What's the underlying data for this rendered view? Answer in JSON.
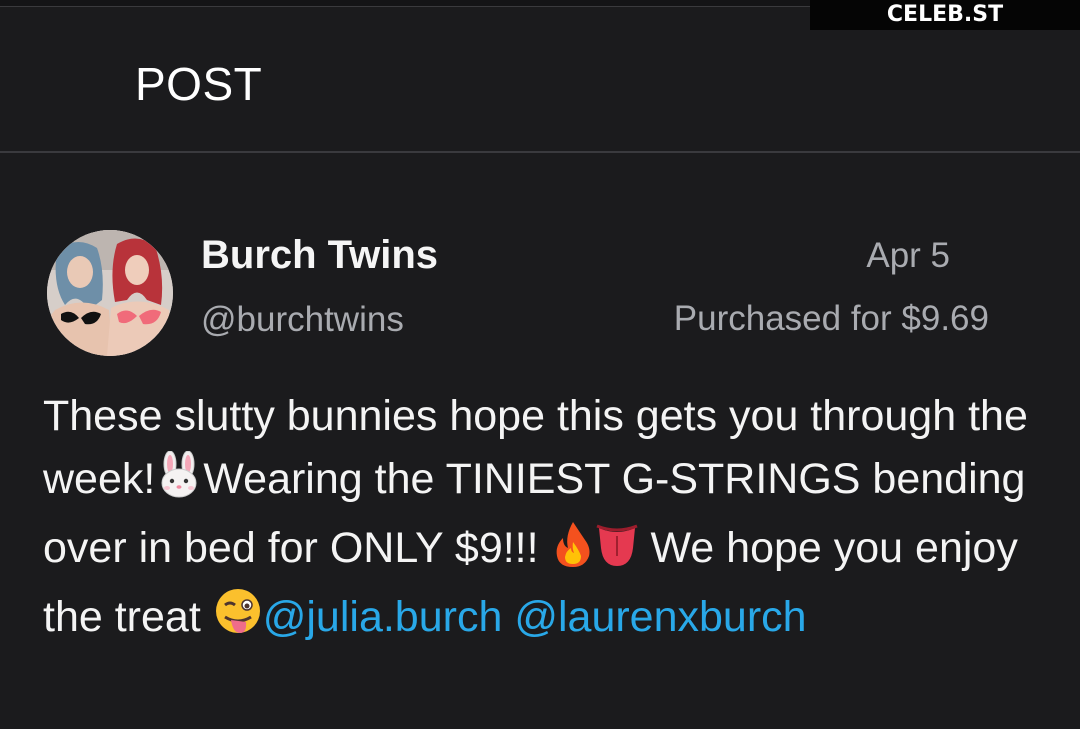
{
  "watermark": "CELEB.ST",
  "header": {
    "title": "POST"
  },
  "post": {
    "author_name": "Burch Twins",
    "author_handle": "@burchtwins",
    "date": "Apr 5",
    "purchase_info": "Purchased for $9.69",
    "text_1": "These slutty bunnies hope this gets you through the week!",
    "text_2": "Wearing the TINIEST G-STRINGS bending over in bed for ONLY $9!!! ",
    "text_3": " We hope you enjoy the treat ",
    "mention_1": "@julia.burch",
    "mention_2": "@laurenxburch",
    "emojis": [
      "rabbit-face-icon",
      "fire-icon",
      "tongue-icon",
      "winking-tongue-face-icon"
    ]
  },
  "colors": {
    "background": "#1b1b1d",
    "text": "#f4f4f4",
    "muted": "#a9abb0",
    "mention": "#29a8e8"
  }
}
